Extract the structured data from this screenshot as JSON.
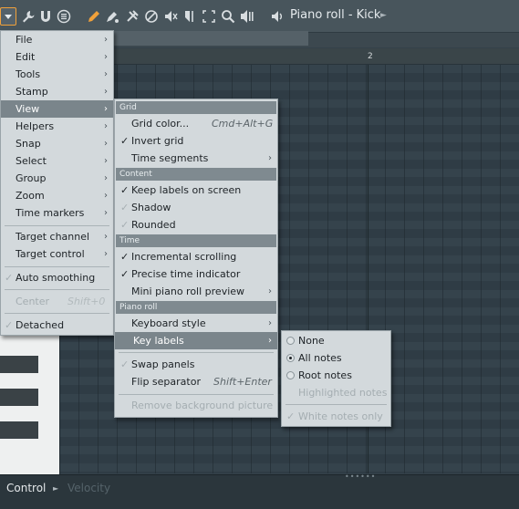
{
  "toolbar": {
    "title": "Piano roll - Kick",
    "icons": [
      "menu-arrow-icon",
      "wrench-icon",
      "magnet-icon",
      "list-icon",
      "pencil-icon",
      "paint-icon",
      "delete-icon",
      "mute-icon",
      "slice-icon",
      "select-icon",
      "zoom-icon",
      "playback-icon",
      "speaker-icon"
    ]
  },
  "ruler": {
    "bar_label": "2"
  },
  "bottom": {
    "control_label": "Control",
    "velocity_label": "Velocity"
  },
  "main_menu": {
    "items": [
      "File",
      "Edit",
      "Tools",
      "Stamp",
      "View",
      "Helpers",
      "Snap",
      "Select",
      "Group",
      "Zoom",
      "Time markers"
    ],
    "target_channel": "Target channel",
    "target_control": "Target control",
    "auto_smoothing": "Auto smoothing",
    "center": "Center",
    "center_shortcut": "Shift+0",
    "detached": "Detached"
  },
  "view_menu": {
    "grid_header": "Grid",
    "grid_color": "Grid color...",
    "grid_color_shortcut": "Cmd+Alt+G",
    "invert_grid": "Invert grid",
    "time_segments": "Time segments",
    "content_header": "Content",
    "keep_labels": "Keep labels on screen",
    "shadow": "Shadow",
    "rounded": "Rounded",
    "time_header": "Time",
    "incremental_scrolling": "Incremental scrolling",
    "precise_time_indicator": "Precise time indicator",
    "mini_preview": "Mini piano roll preview",
    "pianoroll_header": "Piano roll",
    "keyboard_style": "Keyboard style",
    "key_labels": "Key labels",
    "swap_panels": "Swap panels",
    "flip_separator": "Flip separator",
    "flip_separator_shortcut": "Shift+Enter",
    "remove_background": "Remove background picture"
  },
  "key_labels_menu": {
    "none": "None",
    "all_notes": "All notes",
    "root_notes": "Root notes",
    "highlighted_notes": "Highlighted notes",
    "white_notes_only": "White notes only"
  },
  "colors": {
    "accent": "#f1a13a",
    "menu_bg": "#d3d9dc",
    "highlight": "#7a858b"
  }
}
